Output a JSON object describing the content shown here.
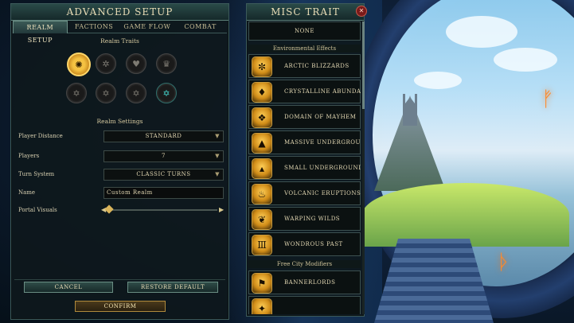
{
  "setup": {
    "title": "ADVANCED SETUP",
    "tabs": [
      "REALM SETUP",
      "FACTIONS",
      "GAME FLOW",
      "COMBAT"
    ],
    "realm_traits_label": "Realm Traits",
    "traits_row1": [
      "sun-trait-icon",
      "spider-trait-icon",
      "heart-trait-icon",
      "crown-trait-icon"
    ],
    "traits_row2": [
      "star-trait-icon",
      "star-trait-icon",
      "star-trait-icon",
      "star-trait-icon"
    ],
    "realm_settings_label": "Realm Settings",
    "player_distance": {
      "label": "Player Distance",
      "value": "STANDARD"
    },
    "players": {
      "label": "Players",
      "value": "7"
    },
    "turn_system": {
      "label": "Turn System",
      "value": "CLASSIC TURNS"
    },
    "name": {
      "label": "Name",
      "value": "Custom Realm"
    },
    "portal_visuals": {
      "label": "Portal Visuals"
    },
    "cancel_label": "CANCEL",
    "restore_label": "RESTORE DEFAULT",
    "confirm_label": "CONFIRM"
  },
  "misc": {
    "title": "MISC TRAIT",
    "none_label": "NONE",
    "env_header": "Environmental Effects",
    "env_items": [
      "ARCTIC BLIZZARDS",
      "CRYSTALLINE ABUNDANCE",
      "DOMAIN OF MAYHEM",
      "MASSIVE UNDERGROUND",
      "SMALL UNDERGROUND",
      "VOLCANIC ERUPTIONS",
      "WARPING WILDS",
      "WONDROUS PAST"
    ],
    "free_city_header": "Free City Modifiers",
    "free_city_items": [
      "BANNERLORDS"
    ]
  },
  "colors": {
    "accent_gold": "#f5c242",
    "panel_border": "#3c5a5a",
    "teal": "#44d1c8"
  }
}
